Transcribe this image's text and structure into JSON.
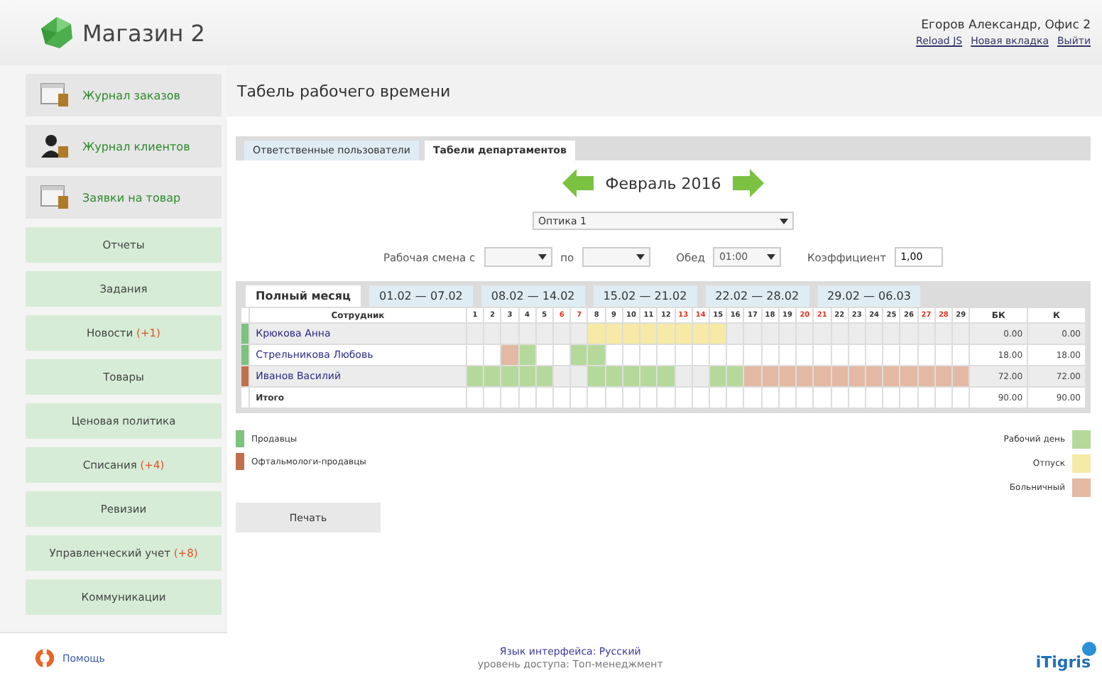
{
  "header": {
    "app_title": "Магазин 2",
    "user": "Егоров Александр, Офис 2",
    "links": [
      "Reload JS",
      "Новая вкладка",
      "Выйти"
    ]
  },
  "sidebar": {
    "items": [
      {
        "kind": "document",
        "label": "Журнал заказов"
      },
      {
        "kind": "person",
        "label": "Журнал клиентов"
      },
      {
        "kind": "document",
        "label": "Заявки на товар"
      },
      {
        "kind": "plain",
        "label": "Отчеты"
      },
      {
        "kind": "plain",
        "label": "Задания"
      },
      {
        "kind": "plain",
        "label": "Новости",
        "badge": "(+1)"
      },
      {
        "kind": "plain",
        "label": "Товары"
      },
      {
        "kind": "plain",
        "label": "Ценовая политика"
      },
      {
        "kind": "plain",
        "label": "Списания",
        "badge": "(+4)"
      },
      {
        "kind": "plain",
        "label": "Ревизии"
      },
      {
        "kind": "plain",
        "label": "Управленческий учет",
        "badge": "(+8)"
      },
      {
        "kind": "plain",
        "label": "Коммуникации"
      }
    ]
  },
  "page_title": "Табель рабочего времени",
  "tabs": [
    {
      "label": "Ответственные пользователи",
      "selected": false
    },
    {
      "label": "Табели департаментов",
      "selected": true
    }
  ],
  "month": "Февраль 2016",
  "department_select": {
    "value": "Оптика 1"
  },
  "filters": {
    "shift_from_label": "Рабочая смена с",
    "shift_to_label": "по",
    "lunch_label": "Обед",
    "lunch_value": "01:00",
    "coef_label": "Коэффициент",
    "coef_value": "1,00"
  },
  "week_tabs": [
    {
      "label": "Полный месяц",
      "selected": true
    },
    {
      "label": "01.02 — 07.02",
      "selected": false
    },
    {
      "label": "08.02 — 14.02",
      "selected": false
    },
    {
      "label": "15.02 — 21.02",
      "selected": false
    },
    {
      "label": "22.02 — 28.02",
      "selected": false
    },
    {
      "label": "29.02 — 06.03",
      "selected": false
    }
  ],
  "table": {
    "employee_header": "Сотрудник",
    "bk_header": "БК",
    "k_header": "К",
    "days": [
      {
        "n": "1",
        "weekend": false
      },
      {
        "n": "2",
        "weekend": false
      },
      {
        "n": "3",
        "weekend": false
      },
      {
        "n": "4",
        "weekend": false
      },
      {
        "n": "5",
        "weekend": false
      },
      {
        "n": "6",
        "weekend": true
      },
      {
        "n": "7",
        "weekend": true
      },
      {
        "n": "8",
        "weekend": false
      },
      {
        "n": "9",
        "weekend": false
      },
      {
        "n": "10",
        "weekend": false
      },
      {
        "n": "11",
        "weekend": false
      },
      {
        "n": "12",
        "weekend": false
      },
      {
        "n": "13",
        "weekend": true
      },
      {
        "n": "14",
        "weekend": true
      },
      {
        "n": "15",
        "weekend": false
      },
      {
        "n": "16",
        "weekend": false
      },
      {
        "n": "17",
        "weekend": false
      },
      {
        "n": "18",
        "weekend": false
      },
      {
        "n": "19",
        "weekend": false
      },
      {
        "n": "20",
        "weekend": true
      },
      {
        "n": "21",
        "weekend": true
      },
      {
        "n": "22",
        "weekend": false
      },
      {
        "n": "23",
        "weekend": false
      },
      {
        "n": "24",
        "weekend": false
      },
      {
        "n": "25",
        "weekend": false
      },
      {
        "n": "26",
        "weekend": false
      },
      {
        "n": "27",
        "weekend": true
      },
      {
        "n": "28",
        "weekend": true
      },
      {
        "n": "29",
        "weekend": false
      }
    ],
    "rows": [
      {
        "kind": "employee",
        "name": "Крюкова Анна",
        "color": "#7dc27d",
        "cells": [
          {
            "kind": "empty"
          },
          {
            "kind": "empty"
          },
          {
            "kind": "empty"
          },
          {
            "kind": "empty"
          },
          {
            "kind": "empty"
          },
          {
            "kind": "empty"
          },
          {
            "kind": "empty"
          },
          {
            "kind": "vacation"
          },
          {
            "kind": "vacation"
          },
          {
            "kind": "vacation"
          },
          {
            "kind": "vacation"
          },
          {
            "kind": "vacation"
          },
          {
            "kind": "vacation"
          },
          {
            "kind": "vacation"
          },
          {
            "kind": "vacation"
          },
          {
            "kind": "empty"
          },
          {
            "kind": "empty"
          },
          {
            "kind": "empty"
          },
          {
            "kind": "empty"
          },
          {
            "kind": "empty"
          },
          {
            "kind": "empty"
          },
          {
            "kind": "empty"
          },
          {
            "kind": "empty"
          },
          {
            "kind": "empty"
          },
          {
            "kind": "empty"
          },
          {
            "kind": "empty"
          },
          {
            "kind": "empty"
          },
          {
            "kind": "empty"
          },
          {
            "kind": "empty"
          }
        ],
        "bk": "0.00",
        "k": "0.00"
      },
      {
        "kind": "employee",
        "name": "Стрельникова Любовь",
        "color": "#7dc27d",
        "cells": [
          {
            "kind": "empty"
          },
          {
            "kind": "empty"
          },
          {
            "kind": "sick"
          },
          {
            "kind": "work"
          },
          {
            "kind": "empty"
          },
          {
            "kind": "empty"
          },
          {
            "kind": "work"
          },
          {
            "kind": "work"
          },
          {
            "kind": "empty"
          },
          {
            "kind": "empty"
          },
          {
            "kind": "empty"
          },
          {
            "kind": "empty"
          },
          {
            "kind": "empty"
          },
          {
            "kind": "empty"
          },
          {
            "kind": "empty"
          },
          {
            "kind": "empty"
          },
          {
            "kind": "empty"
          },
          {
            "kind": "empty"
          },
          {
            "kind": "empty"
          },
          {
            "kind": "empty"
          },
          {
            "kind": "empty"
          },
          {
            "kind": "empty"
          },
          {
            "kind": "empty"
          },
          {
            "kind": "empty"
          },
          {
            "kind": "empty"
          },
          {
            "kind": "empty"
          },
          {
            "kind": "empty"
          },
          {
            "kind": "empty"
          },
          {
            "kind": "empty"
          }
        ],
        "bk": "18.00",
        "k": "18.00"
      },
      {
        "kind": "employee",
        "name": "Иванов Василий",
        "color": "#c0704a",
        "cells": [
          {
            "kind": "work"
          },
          {
            "kind": "work"
          },
          {
            "kind": "work"
          },
          {
            "kind": "work"
          },
          {
            "kind": "work"
          },
          {
            "kind": "empty"
          },
          {
            "kind": "empty"
          },
          {
            "kind": "work"
          },
          {
            "kind": "work"
          },
          {
            "kind": "work"
          },
          {
            "kind": "work"
          },
          {
            "kind": "work"
          },
          {
            "kind": "empty"
          },
          {
            "kind": "empty"
          },
          {
            "kind": "work"
          },
          {
            "kind": "work"
          },
          {
            "kind": "sick"
          },
          {
            "kind": "sick"
          },
          {
            "kind": "sick"
          },
          {
            "kind": "sick"
          },
          {
            "kind": "sick"
          },
          {
            "kind": "sick"
          },
          {
            "kind": "sick"
          },
          {
            "kind": "sick"
          },
          {
            "kind": "sick"
          },
          {
            "kind": "sick"
          },
          {
            "kind": "sick"
          },
          {
            "kind": "sick"
          },
          {
            "kind": "sick"
          }
        ],
        "bk": "72.00",
        "k": "72.00"
      },
      {
        "kind": "total",
        "name": "Итого",
        "cells": [
          {
            "kind": "empty"
          },
          {
            "kind": "empty"
          },
          {
            "kind": "empty"
          },
          {
            "kind": "empty"
          },
          {
            "kind": "empty"
          },
          {
            "kind": "empty"
          },
          {
            "kind": "empty"
          },
          {
            "kind": "empty"
          },
          {
            "kind": "empty"
          },
          {
            "kind": "empty"
          },
          {
            "kind": "empty"
          },
          {
            "kind": "empty"
          },
          {
            "kind": "empty"
          },
          {
            "kind": "empty"
          },
          {
            "kind": "empty"
          },
          {
            "kind": "empty"
          },
          {
            "kind": "empty"
          },
          {
            "kind": "empty"
          },
          {
            "kind": "empty"
          },
          {
            "kind": "empty"
          },
          {
            "kind": "empty"
          },
          {
            "kind": "empty"
          },
          {
            "kind": "empty"
          },
          {
            "kind": "empty"
          },
          {
            "kind": "empty"
          },
          {
            "kind": "empty"
          },
          {
            "kind": "empty"
          },
          {
            "kind": "empty"
          },
          {
            "kind": "empty"
          }
        ],
        "bk": "90.00",
        "k": "90.00"
      }
    ]
  },
  "groups_legend": [
    {
      "label": "Продавцы",
      "color": "#7dc27d"
    },
    {
      "label": "Офтальмологи-продавцы",
      "color": "#c0704a"
    }
  ],
  "day_legend": [
    {
      "label": "Рабочий день",
      "color": "#b5d99a"
    },
    {
      "label": "Отпуск",
      "color": "#f7e9a6"
    },
    {
      "label": "Больничный",
      "color": "#e3b9a3"
    }
  ],
  "print_button": "Печать",
  "footer": {
    "help": "Помощь",
    "language": "Язык интерфейса: Русский",
    "access": "уровень доступа: Топ-менеджмент",
    "brand": "iTigris"
  }
}
